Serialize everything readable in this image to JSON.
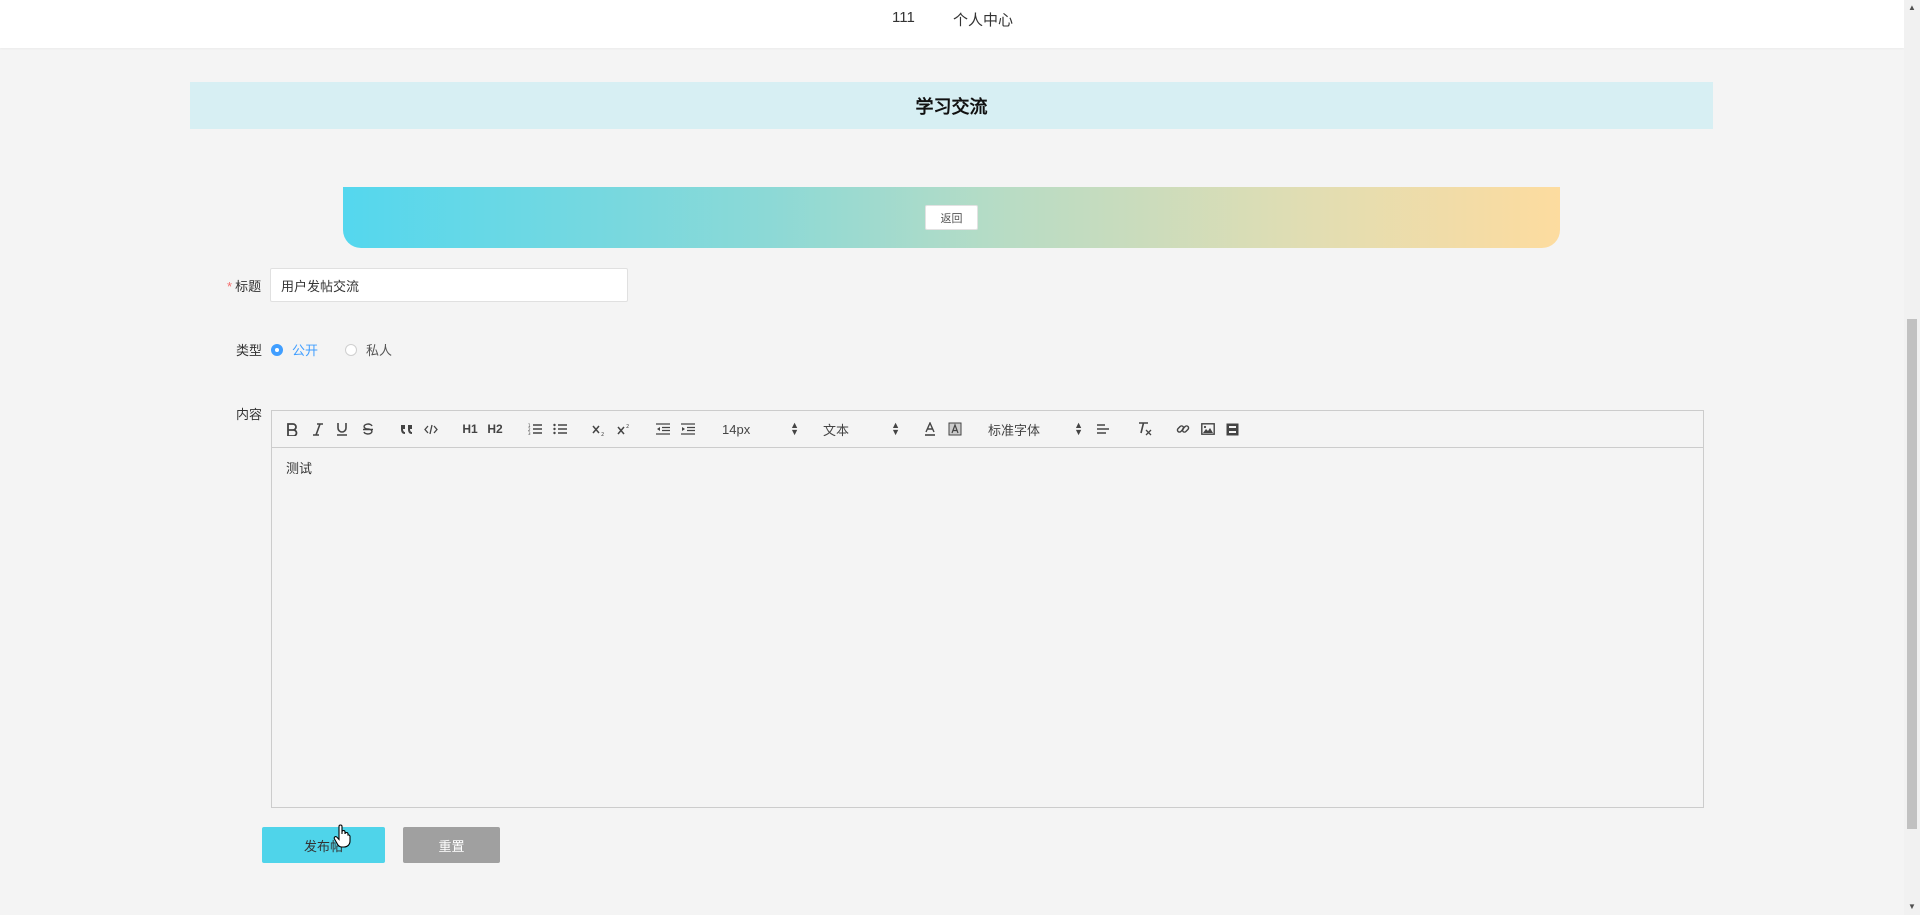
{
  "header": {
    "username": "111",
    "personal_center": "个人中心"
  },
  "banner": {
    "title": "学习交流"
  },
  "back_button": "返回",
  "form": {
    "title_label": "标题",
    "title_required_mark": "*",
    "title_value": "用户发帖交流",
    "type_label": "类型",
    "type_options": [
      {
        "label": "公开",
        "checked": true
      },
      {
        "label": "私人",
        "checked": false
      }
    ],
    "content_label": "内容"
  },
  "editor": {
    "toolbar": {
      "h1": "H1",
      "h2": "H2",
      "font_size": "14px",
      "header_select": "文本",
      "font_family": "标准字体"
    },
    "content": "测试"
  },
  "buttons": {
    "post": "发布帖",
    "reset": "重置"
  },
  "colors": {
    "accent_blue": "#409eff",
    "post_button": "#4fd4ea",
    "reset_button": "#a0a0a0",
    "banner_bg": "#d7eff3",
    "gradient_start": "#54d7ee",
    "gradient_end": "#fddc9f"
  },
  "icons": [
    "bold-icon",
    "italic-icon",
    "underline-icon",
    "strike-icon",
    "blockquote-icon",
    "code-block-icon",
    "ordered-list-icon",
    "bullet-list-icon",
    "subscript-icon",
    "superscript-icon",
    "outdent-icon",
    "indent-icon",
    "font-color-icon",
    "background-color-icon",
    "align-icon",
    "clear-format-icon",
    "link-icon",
    "image-icon",
    "video-icon",
    "hand-cursor-icon"
  ]
}
